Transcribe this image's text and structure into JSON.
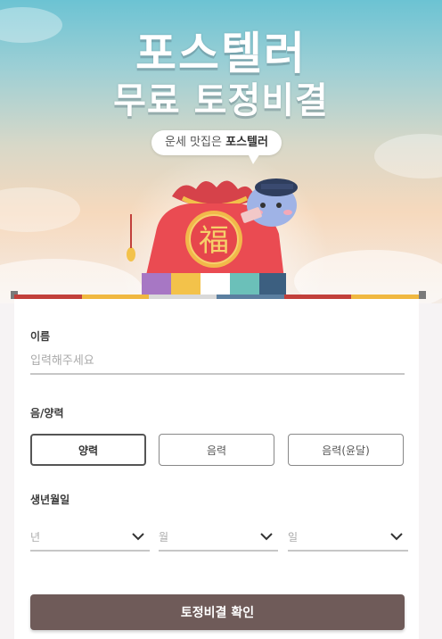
{
  "hero": {
    "title_line1": "포스텔러",
    "title_line2": "무료 토정비결",
    "bubble_text": "운세 맛집은",
    "bubble_brand": "포스텔러"
  },
  "form": {
    "name": {
      "label": "이름",
      "placeholder": "입력해주세요",
      "value": ""
    },
    "calendar": {
      "label": "음/양력",
      "options": [
        "양력",
        "음력",
        "음력(윤달)"
      ],
      "selected": "양력"
    },
    "birth": {
      "label": "생년월일",
      "year_placeholder": "년",
      "month_placeholder": "월",
      "day_placeholder": "일"
    },
    "submit_label": "토정비결 확인"
  },
  "colors": {
    "accent_brown": "#6f5b59",
    "stripe": [
      "#c2403b",
      "#f0b840",
      "#f5f5f5",
      "#5b7fa0",
      "#f0b840",
      "#c2403b"
    ]
  }
}
